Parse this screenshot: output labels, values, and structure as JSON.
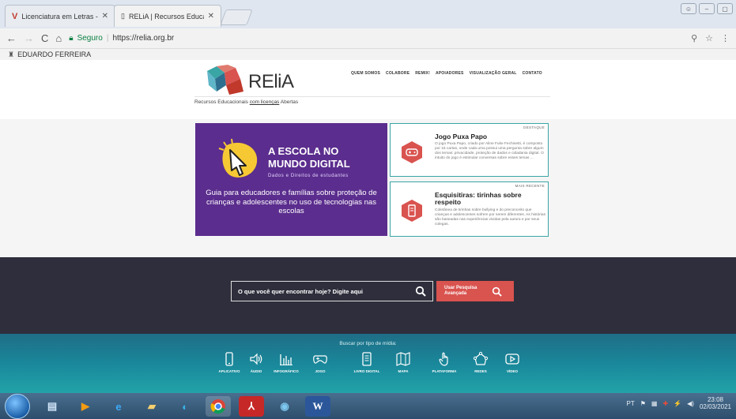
{
  "browser": {
    "tabs": [
      {
        "label": "Licenciatura em Letras -",
        "favicon": "v-icon"
      },
      {
        "label": "RELiA | Recursos Educacio",
        "favicon": "page-icon"
      }
    ],
    "address": {
      "secure_label": "Seguro",
      "url": "https://relia.org.br"
    },
    "bookmark": "EDUARDO FERREIRA"
  },
  "site": {
    "brand": "REliA",
    "nav": [
      "QUEM SOMOS",
      "COLABORE",
      "REMIX!",
      "APOIADORES",
      "VISUALIZAÇÃO GERAL",
      "CONTATO"
    ],
    "tagline_pre": "Recursos Educacionais ",
    "tagline_link": "com licenças",
    "tagline_post": " Abertas"
  },
  "banner": {
    "title": "A ESCOLA NO MUNDO DIGITAL",
    "subtitle": "Dados e Direitos de estudantes",
    "body": "Guia para educadores e famílias sobre proteção de crianças e adolescentes no uso de tecnologias nas escolas",
    "color": "#5b2d8e"
  },
  "cards": [
    {
      "badge": "DESTAQUE",
      "title": "Jogo Puxa Papo",
      "desc": "O jogo Puxa Papo, criado por Aline Fuke Fechinetti, é composto por 15 cartas, onde cada uma possui uma pergunta sobre algum dos temas: privacidade, proteção de dados e cidadania digital. O intuito do jogo é estimular conversas sobre esses temas ...",
      "icon": "gamepad-icon"
    },
    {
      "badge": "MAIS RECENTE",
      "title": "Esquisitiras: tirinhas sobre respeito",
      "desc": "Coletânea de tirinhas sobre bullying e do preconceito que crianças e adolescentes sofrem por serem diferentes. As histórias são baseadas nas experiências vividas pela autora e por seus colegas.",
      "icon": "tablet-icon"
    }
  ],
  "search": {
    "placeholder": "O que você quer encontrar hoje? Digite aqui",
    "advanced": "Usar Pesquisa Avançada"
  },
  "media": {
    "label": "Buscar por tipo de mídia:",
    "items": [
      {
        "label": "APLICATIVO",
        "icon": "phone-icon"
      },
      {
        "label": "ÁUDIO",
        "icon": "speaker-icon"
      },
      {
        "label": "INFOGRÁFICO",
        "icon": "bars-icon"
      },
      {
        "label": "JOGO",
        "icon": "gamepad-icon"
      },
      {
        "label": "LIVRO DIGITAL",
        "icon": "ebook-icon"
      },
      {
        "label": "MAPA",
        "icon": "map-icon"
      },
      {
        "label": "PLATAFORMA",
        "icon": "hand-icon"
      },
      {
        "label": "REDES",
        "icon": "network-icon"
      },
      {
        "label": "VÍDEO",
        "icon": "play-icon"
      }
    ]
  },
  "taskbar": {
    "lang": "PT",
    "time": "23:08",
    "date": "02/03/2021"
  }
}
